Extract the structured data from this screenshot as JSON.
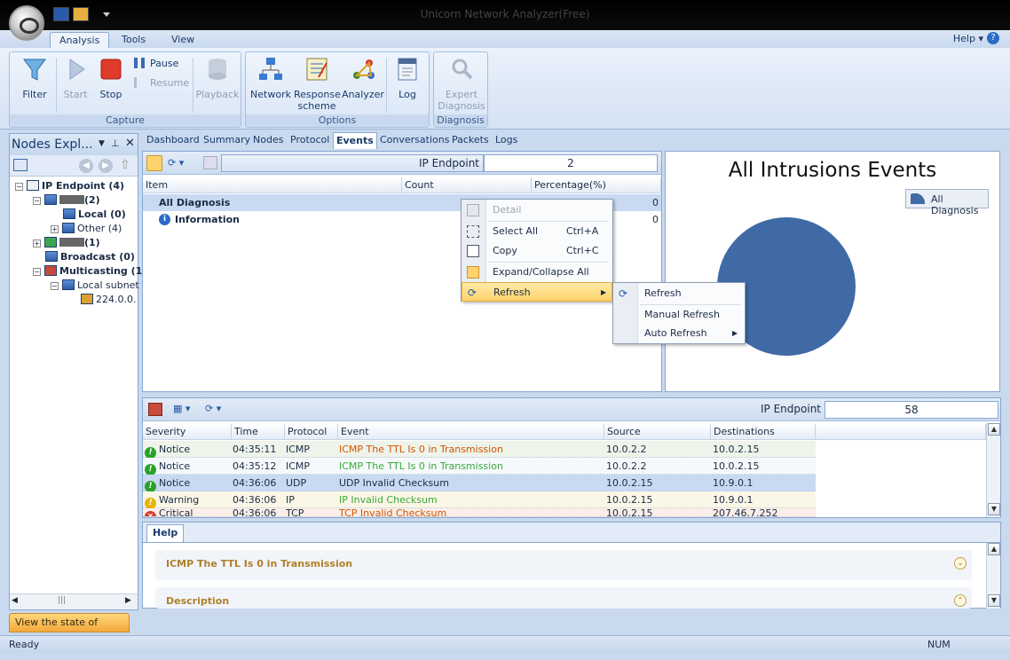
{
  "window": {
    "title": "Unicorn Network Analyzer(Free)"
  },
  "ribbon_tabs": [
    "Analysis",
    "Tools",
    "View"
  ],
  "help_menu": "Help",
  "help_q": "?",
  "ribbon": {
    "capture": {
      "label": "Capture",
      "filter": "Filter",
      "start": "Start",
      "stop": "Stop",
      "pause": "Pause",
      "resume": "Resume",
      "playback": "Playback"
    },
    "options": {
      "label": "Options",
      "network": "Network",
      "response_scheme": "Response scheme",
      "analyzer": "Analyzer",
      "log": "Log"
    },
    "diagnosis": {
      "label": "Diagnosis",
      "expert_diagnosis": "Expert Diagnosis"
    }
  },
  "left_panel": {
    "title": "Nodes Expl...",
    "tree": [
      {
        "label": "IP Endpoint (4)",
        "bold": true
      },
      {
        "label": "(2)",
        "bold": true
      },
      {
        "label": "Local (0)",
        "bold": true
      },
      {
        "label": "Other (4)",
        "bold": false
      },
      {
        "label": "(1)",
        "bold": true
      },
      {
        "label": "Broadcast (0)",
        "bold": true
      },
      {
        "label": "Multicasting (1",
        "bold": true
      },
      {
        "label": "Local subnet",
        "bold": false
      },
      {
        "label": "224.0.0.",
        "bold": false
      }
    ]
  },
  "main_tabs": [
    "Dashboard",
    "Summary",
    "Nodes",
    "Protocol",
    "Events",
    "Conversations",
    "Packets",
    "Logs"
  ],
  "events_top": {
    "ip_label": "IP Endpoint",
    "ip_value": "2",
    "columns": [
      "Item",
      "Count",
      "Percentage(%)"
    ],
    "rows": [
      {
        "item": "All Diagnosis",
        "count": "",
        "percentage": "0"
      },
      {
        "item": "Information",
        "count": "",
        "percentage": "0"
      }
    ]
  },
  "chart": {
    "title": "All Intrusions Events",
    "legend": "All Diagnosis",
    "color": "#3f6aa6"
  },
  "chart_data": {
    "type": "pie",
    "title": "All Intrusions Events",
    "categories": [
      "All Diagnosis"
    ],
    "values": [
      100
    ],
    "legend": "top-right"
  },
  "context_menu": {
    "items": [
      {
        "label": "Detail",
        "shortcut": "",
        "disabled": true
      },
      {
        "label": "Select All",
        "shortcut": "Ctrl+A"
      },
      {
        "label": "Copy",
        "shortcut": "Ctrl+C"
      },
      {
        "label": "Expand/Collapse All",
        "shortcut": ""
      },
      {
        "label": "Refresh",
        "shortcut": "",
        "highlighted": true
      }
    ]
  },
  "submenu": {
    "items": [
      "Refresh",
      "Manual Refresh",
      "Auto Refresh"
    ]
  },
  "events_bottom": {
    "ip_label": "IP Endpoint",
    "ip_value": "58",
    "columns": [
      "Severity",
      "Time",
      "Protocol",
      "Event",
      "Source",
      "Destinations"
    ],
    "rows": [
      {
        "severity": "Notice",
        "time": "04:35:11",
        "protocol": "ICMP",
        "event": "ICMP The TTL Is 0 in Transmission",
        "source": "10.0.2.2",
        "dest": "10.0.2.15",
        "event_color": "#d35400",
        "sev_color": "#2aa22a"
      },
      {
        "severity": "Notice",
        "time": "04:35:12",
        "protocol": "ICMP",
        "event": "ICMP The TTL Is 0 in Transmission",
        "source": "10.0.2.2",
        "dest": "10.0.2.15",
        "event_color": "#3aa83a",
        "sev_color": "#2aa22a"
      },
      {
        "severity": "Notice",
        "time": "04:36:06",
        "protocol": "UDP",
        "event": "UDP Invalid Checksum",
        "source": "10.0.2.15",
        "dest": "10.9.0.1",
        "event_color": "#1b2b45",
        "sev_color": "#2aa22a"
      },
      {
        "severity": "Warning",
        "time": "04:36:06",
        "protocol": "IP",
        "event": "IP Invalid Checksum",
        "source": "10.0.2.15",
        "dest": "10.9.0.1",
        "event_color": "#3aa83a",
        "sev_color": "#e8b400"
      },
      {
        "severity": "Critical",
        "time": "04:36:06",
        "protocol": "TCP",
        "event": "TCP Invalid Checksum",
        "source": "10.0.2.15",
        "dest": "207.46.7.252",
        "event_color": "#d35400",
        "sev_color": "#d63a2a"
      }
    ]
  },
  "help_panel": {
    "tab": "Help",
    "card_title": "ICMP The TTL Is 0 in Transmission",
    "card2_title": "Description"
  },
  "state_tab": "View the state of Unicorn.",
  "status": {
    "text": "Ready",
    "num": "NUM"
  }
}
